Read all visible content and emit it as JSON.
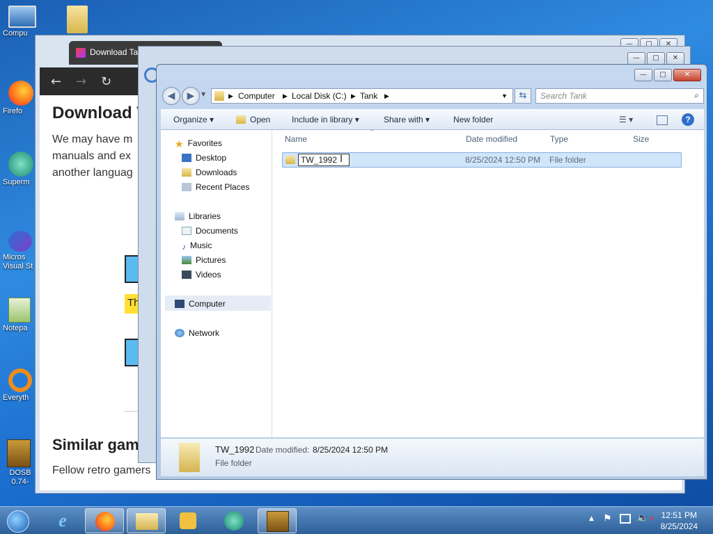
{
  "desktop_icons": [
    {
      "label": "Compu"
    },
    {
      "label": "Firefo"
    },
    {
      "label": "Superm"
    },
    {
      "label": "Micros Visual St"
    },
    {
      "label": "Notepa"
    },
    {
      "label": "Everyth"
    },
    {
      "label": "DOSB 0.74-"
    }
  ],
  "browser": {
    "tab_title": "Download Ta",
    "heading": "Download T",
    "paragraph_lines": [
      "We may have m",
      "manuals and ex",
      "another languag"
    ],
    "similar_heading": "Similar gam",
    "fellow_text": "Fellow retro gamers",
    "yellow_snippet": "Th"
  },
  "explorer": {
    "breadcrumbs": [
      "Computer",
      "Local Disk (C:)",
      "Tank"
    ],
    "search_placeholder": "Search Tank",
    "toolbar": {
      "organize": "Organize",
      "open": "Open",
      "include_in_library": "Include in library",
      "share_with": "Share with",
      "new_folder": "New folder"
    },
    "nav": {
      "favorites": "Favorites",
      "desktop": "Desktop",
      "downloads": "Downloads",
      "recent_places": "Recent Places",
      "libraries": "Libraries",
      "documents": "Documents",
      "music": "Music",
      "pictures": "Pictures",
      "videos": "Videos",
      "computer": "Computer",
      "network": "Network"
    },
    "columns": {
      "name": "Name",
      "date_modified": "Date modified",
      "type": "Type",
      "size": "Size"
    },
    "files": [
      {
        "name": "TW_1992",
        "date_modified": "8/25/2024 12:50 PM",
        "type": "File folder",
        "size": ""
      }
    ],
    "details": {
      "name": "TW_1992",
      "date_label": "Date modified:",
      "date_value": "8/25/2024 12:50 PM",
      "type": "File folder"
    }
  },
  "taskbar": {
    "time": "12:51 PM",
    "date": "8/25/2024"
  },
  "colors": {
    "accent": "#3b78c4",
    "selection": "#cfe6fb"
  }
}
